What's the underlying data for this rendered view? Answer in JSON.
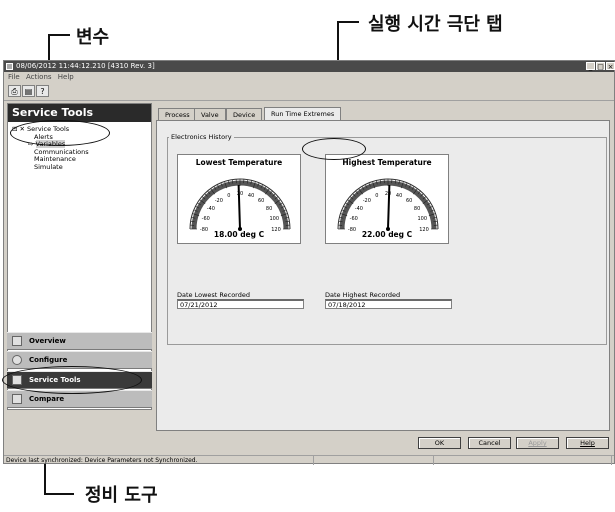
{
  "callouts": {
    "variables_ko": "변수",
    "runtime_tab_ko": "실행 시간 극단 탭",
    "service_tools_ko": "정비 도구"
  },
  "window": {
    "title": "08/06/2012 11:44:12.210 [4310 Rev. 3]",
    "controls": [
      "_",
      "□",
      "×"
    ]
  },
  "menu": [
    "File",
    "Actions",
    "Help"
  ],
  "toolbar": {
    "icons": [
      "printer-icon",
      "print-preview-icon",
      "help-pointer-icon"
    ]
  },
  "left_pane": {
    "header": "Service Tools",
    "tree": {
      "root": "Service Tools",
      "items": [
        "Alerts",
        "Variables",
        "Communications",
        "Maintenance",
        "Simulate"
      ],
      "selected": "Variables"
    }
  },
  "nav": [
    {
      "label": "Overview",
      "icon": "home-icon",
      "active": false
    },
    {
      "label": "Configure",
      "icon": "configure-icon",
      "active": false
    },
    {
      "label": "Service Tools",
      "icon": "tools-icon",
      "active": true
    },
    {
      "label": "Compare",
      "icon": "compare-icon",
      "active": false
    }
  ],
  "tabs": [
    "Process",
    "Valve",
    "Device",
    "Run Time Extremes"
  ],
  "active_tab": "Run Time Extremes",
  "electronics": {
    "group_label": "Electronics History",
    "lowest": {
      "title": "Lowest Temperature",
      "value_text": "18.00 deg C",
      "value": 18,
      "scale_labels": [
        "-80",
        "-60",
        "-40",
        "-20",
        "0",
        "20",
        "40",
        "60",
        "80",
        "100",
        "120"
      ],
      "date_label": "Date Lowest Recorded",
      "date_value": "07/21/2012"
    },
    "highest": {
      "title": "Highest Temperature",
      "value_text": "22.00 deg C",
      "value": 22,
      "scale_labels": [
        "-80",
        "-60",
        "-40",
        "-20",
        "0",
        "20",
        "40",
        "60",
        "80",
        "100",
        "120"
      ],
      "date_label": "Date Highest Recorded",
      "date_value": "07/18/2012"
    }
  },
  "buttons": [
    {
      "label": "OK",
      "enabled": true
    },
    {
      "label": "Cancel",
      "enabled": true
    },
    {
      "label": "Apply",
      "enabled": false
    },
    {
      "label": "Help",
      "enabled": true
    }
  ],
  "status": {
    "text": "Device last synchronized: Device Parameters not Synchronized."
  }
}
